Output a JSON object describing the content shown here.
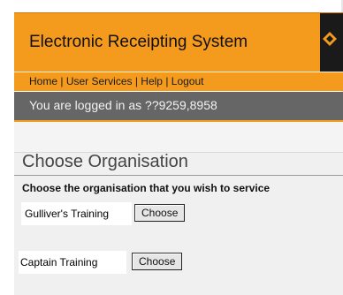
{
  "header": {
    "app_title": "Electronic Receipting System",
    "logo_icon": "diamond-logo-icon"
  },
  "nav": {
    "links": [
      "Home",
      "User Services",
      "Help",
      "Logout"
    ],
    "separator": " | "
  },
  "session": {
    "login_text": "You are logged in as ??9259,8958"
  },
  "main": {
    "page_title": "Choose Organisation",
    "instructions": "Choose the organisation that you wish to service",
    "organisations": [
      {
        "name": "Gulliver's Training",
        "button_label": "Choose"
      },
      {
        "name": "Captain Training",
        "button_label": "Choose"
      }
    ]
  },
  "colors": {
    "accent_orange": "#f49a1c",
    "login_bar_gray": "#666666"
  }
}
